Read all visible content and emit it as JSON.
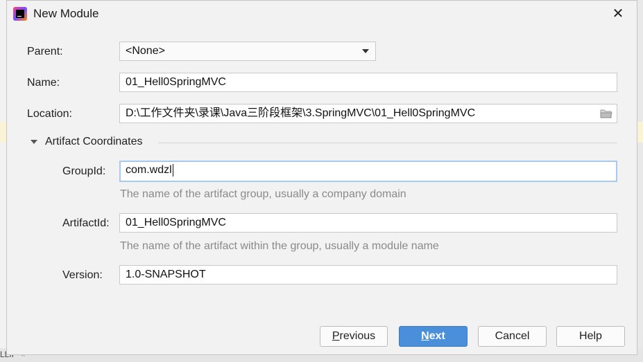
{
  "background": {
    "bottom_left_text": "LLII",
    "bottom_left_text2": "«"
  },
  "dialog": {
    "title": "New Module",
    "close_glyph": "✕"
  },
  "form": {
    "parent_label": "Parent:",
    "parent_value": "<None>",
    "name_label": "Name:",
    "name_value": "01_Hell0SpringMVC",
    "location_label": "Location:",
    "location_value": "D:\\工作文件夹\\录课\\Java三阶段框架\\3.SpringMVC\\01_Hell0SpringMVC"
  },
  "artifact": {
    "section_title": "Artifact Coordinates",
    "groupid_label": "GroupId:",
    "groupid_value": "com.wdzl",
    "groupid_hint": "The name of the artifact group, usually a company domain",
    "artifactid_label": "ArtifactId:",
    "artifactid_value": "01_Hell0SpringMVC",
    "artifactid_hint": "The name of the artifact within the group, usually a module name",
    "version_label": "Version:",
    "version_value": "1.0-SNAPSHOT"
  },
  "buttons": {
    "previous_mnemonic": "P",
    "previous_rest": "revious",
    "next_mnemonic": "N",
    "next_rest": "ext",
    "cancel": "Cancel",
    "help": "Help"
  },
  "colors": {
    "primary_button": "#4a8fd9",
    "focus_border": "#a5c9ef",
    "hint_text": "#8a8a8a"
  }
}
